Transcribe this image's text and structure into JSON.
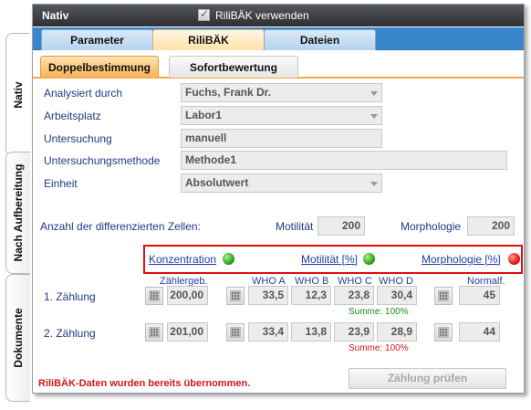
{
  "side_tabs": [
    {
      "label": "Nativ"
    },
    {
      "label": "Nach Aufbereitung"
    },
    {
      "label": "Dokumente"
    }
  ],
  "window": {
    "title": "Nativ",
    "rilibak_checkbox_label": "RiliBÄK verwenden",
    "rilibak_checked": true
  },
  "main_tabs": [
    {
      "label": "Parameter",
      "active": false
    },
    {
      "label": "RiliBÄK",
      "active": true
    },
    {
      "label": "Dateien",
      "active": false
    }
  ],
  "sub_tabs": [
    {
      "label": "Doppelbestimmung",
      "active": true
    },
    {
      "label": "Sofortbewertung",
      "active": false
    }
  ],
  "form": {
    "analysiert_label": "Analysiert durch",
    "analysiert_value": "Fuchs, Frank Dr.",
    "arbeitsplatz_label": "Arbeitsplatz",
    "arbeitsplatz_value": "Labor1",
    "untersuchung_label": "Untersuchung",
    "untersuchung_value": "manuell",
    "methode_label": "Untersuchungsmethode",
    "methode_value": "Methode1",
    "einheit_label": "Einheit",
    "einheit_value": "Absolutwert"
  },
  "cells": {
    "label": "Anzahl der differenzierten Zellen:",
    "motilitaet_label": "Motilität",
    "motilitaet_value": "200",
    "morphologie_label": "Morphologie",
    "morphologie_value": "200"
  },
  "indicators": {
    "konzentration": "Konzentration",
    "konzentration_status": "green",
    "motilitaet": "Motilität [%]",
    "motilitaet_status": "green",
    "morphologie": "Morphologie [%]",
    "morphologie_status": "red"
  },
  "columns": {
    "zaehlergeb": "Zählergeb.",
    "who_a": "WHO A",
    "who_b": "WHO B",
    "who_c": "WHO C",
    "who_d": "WHO  D",
    "normalf": "Normalf."
  },
  "rows": [
    {
      "label": "1. Zählung",
      "zaehlergeb": "200,00",
      "who_a": "33,5",
      "who_b": "12,3",
      "who_c": "23,8",
      "who_d": "30,4",
      "summe": "Summe: 100%",
      "summe_color": "#1a8a1a",
      "normalf": "45"
    },
    {
      "label": "2. Zählung",
      "zaehlergeb": "201,00",
      "who_a": "33,4",
      "who_b": "13,8",
      "who_c": "23,9",
      "who_d": "28,9",
      "summe": "Summe: 100%",
      "summe_color": "#d21818",
      "normalf": "44"
    }
  ],
  "status_message": "RiliBÄK-Daten wurden bereits übernommen.",
  "check_button": "Zählung prüfen"
}
